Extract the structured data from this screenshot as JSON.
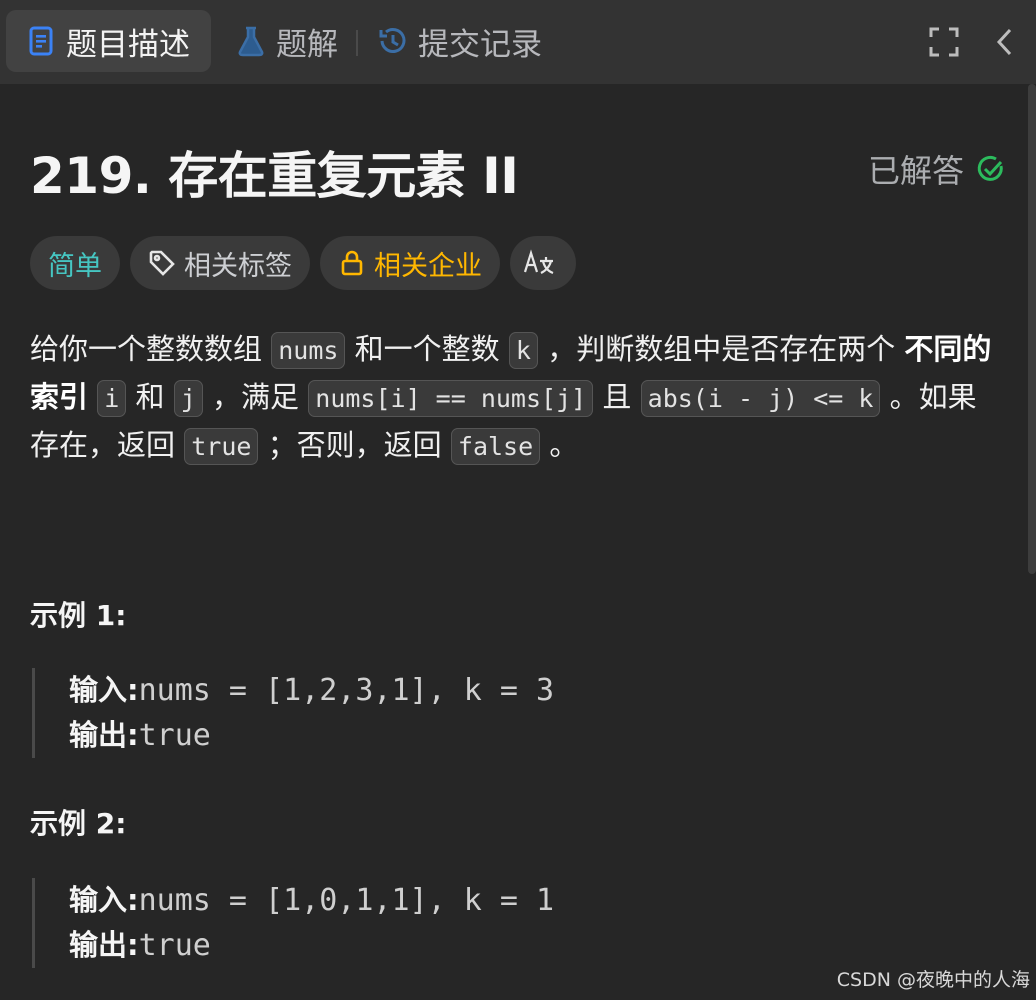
{
  "tabs": [
    {
      "label": "题目描述",
      "icon": "document-icon",
      "active": true
    },
    {
      "label": "题解",
      "icon": "flask-icon",
      "active": false
    },
    {
      "label": "提交记录",
      "icon": "history-icon",
      "active": false
    }
  ],
  "toolbar": {
    "fullscreen_icon": "fullscreen-icon",
    "collapse_icon": "chevron-left-icon"
  },
  "problem": {
    "title": "219. 存在重复元素 II",
    "status": "已解答",
    "tags": {
      "difficulty": "简单",
      "related_tags": "相关标签",
      "related_companies": "相关企业",
      "translate": "A文"
    },
    "description": {
      "p1": "给你一个整数数组",
      "code_nums": "nums",
      "p2": "和一个整数",
      "code_k": "k",
      "p3": "，判断数组中是否存在两个",
      "bold": "不同的索引",
      "code_i": "i",
      "p4": "和",
      "code_j": "j",
      "p5": "，满足",
      "code_eq": "nums[i] == nums[j]",
      "p6": "且",
      "code_abs": "abs(i - j) <= k",
      "p7": "。如果存在，返回",
      "code_true": "true",
      "p8": "；否则，返回",
      "code_false": "false",
      "p9": "。"
    }
  },
  "examples": [
    {
      "title": "示例 1:",
      "input_label": "输入:",
      "input": "nums = [1,2,3,1], k = 3",
      "output_label": "输出:",
      "output": "true"
    },
    {
      "title": "示例 2:",
      "input_label": "输入:",
      "input": "nums = [1,0,1,1], k = 1",
      "output_label": "输出:",
      "output": "true"
    }
  ],
  "watermark": "CSDN @夜晚中的人海",
  "colors": {
    "easy": "#46c6c2",
    "company": "#ffb700",
    "solved": "#2cbb5d",
    "tab_blue": "#3b82f6"
  }
}
